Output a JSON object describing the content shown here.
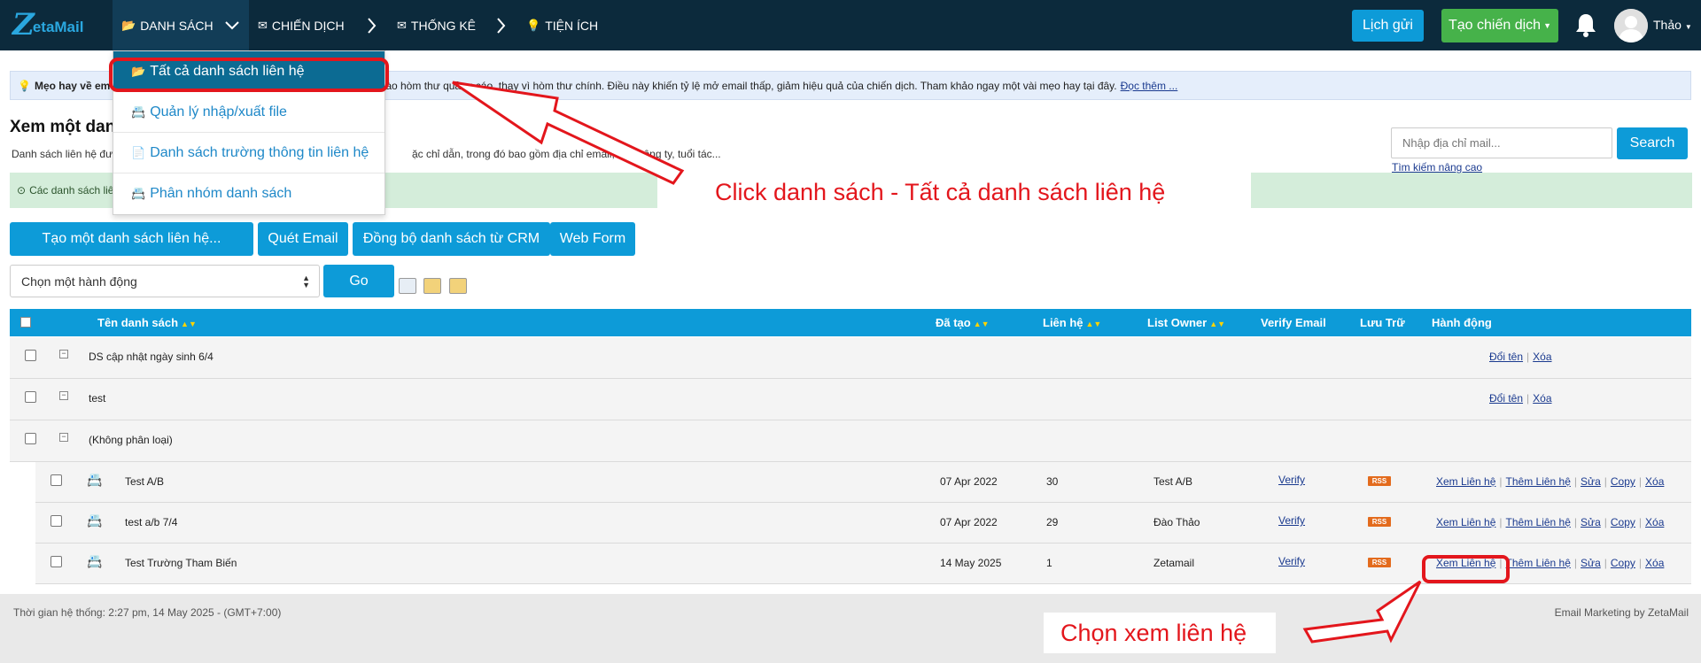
{
  "app": {
    "logo_z": "Z",
    "logo_rest": "etaMail"
  },
  "nav": {
    "danh_sach": "DANH SÁCH",
    "chien_dich": "CHIẾN DỊCH",
    "thong_ke": "THỐNG KÊ",
    "tien_ich": "TIỆN ÍCH",
    "lich_gui": "Lịch gửi",
    "tao_chien_dich": "Tạo chiến dịch",
    "user": "Thảo"
  },
  "dropdown": {
    "items": [
      {
        "label": "Tất cả danh sách liên hệ"
      },
      {
        "label": "Quản lý nhập/xuất file"
      },
      {
        "label": "Danh sách trường thông tin liên hệ"
      },
      {
        "label": "Phân nhóm danh sách"
      }
    ]
  },
  "tip": {
    "prefix": "Mẹo hay về em",
    "text": "vào hòm thư quảng cáo, thay vì hòm thư chính. Điều này khiến tỷ lệ mở email thấp, giảm hiệu quả của chiến dịch. Tham khảo ngay một vài mẹo hay tại đây.",
    "link": "Đọc thêm ..."
  },
  "page": {
    "title": "Xem một dan",
    "desc_prefix": "Danh sách liên hệ đượ",
    "desc_suffix": "ặc chỉ dẫn, trong đó bao gồm địa chỉ email, tên, công ty, tuổi tác...",
    "info": "Các danh sách liê"
  },
  "search": {
    "placeholder": "Nhập địa chỉ mail...",
    "button": "Search",
    "advanced": "Tìm kiếm nâng cao"
  },
  "actions": {
    "create_list": "Tạo một danh sách liên hệ...",
    "scan_email": "Quét Email",
    "sync_crm": "Đồng bộ danh sách từ CRM",
    "web_form": "Web Form",
    "select": "Chọn một hành động",
    "go": "Go"
  },
  "table": {
    "headers": {
      "name": "Tên danh sách",
      "created": "Đã tạo",
      "contacts": "Liên hệ",
      "owner": "List Owner",
      "verify": "Verify Email",
      "archive": "Lưu Trữ",
      "action": "Hành động"
    },
    "groups": [
      {
        "name": "DS cập nhật ngày sinh 6/4",
        "rename": "Đổi tên",
        "delete": "Xóa"
      },
      {
        "name": "test",
        "rename": "Đổi tên",
        "delete": "Xóa"
      },
      {
        "name": "(Không phân loại)"
      }
    ],
    "lists": [
      {
        "name": "Test A/B",
        "created": "07 Apr 2022",
        "contacts": "30",
        "owner": "Test A/B",
        "verify": "Verify",
        "rss": "RSS"
      },
      {
        "name": "test a/b 7/4",
        "created": "07 Apr 2022",
        "contacts": "29",
        "owner": "Đào Thảo",
        "verify": "Verify",
        "rss": "RSS"
      },
      {
        "name": "Test Trường Tham Biến",
        "created": "14 May 2025",
        "contacts": "1",
        "owner": "Zetamail",
        "verify": "Verify",
        "rss": "RSS"
      }
    ],
    "row_actions": {
      "view": "Xem Liên hệ",
      "add": "Thêm Liên hệ",
      "edit": "Sửa",
      "copy": "Copy",
      "delete": "Xóa"
    }
  },
  "footer": {
    "system_time": "Thời gian hệ thống: 2:27 pm, 14 May 2025 - (GMT+7:00)",
    "brand": "Email Marketing by ZetaMail"
  },
  "annotations": {
    "click_list": "Click danh sách - Tất cả danh sách liên hệ",
    "choose_view": "Chọn xem liên hệ",
    "color": "#e3161c"
  }
}
